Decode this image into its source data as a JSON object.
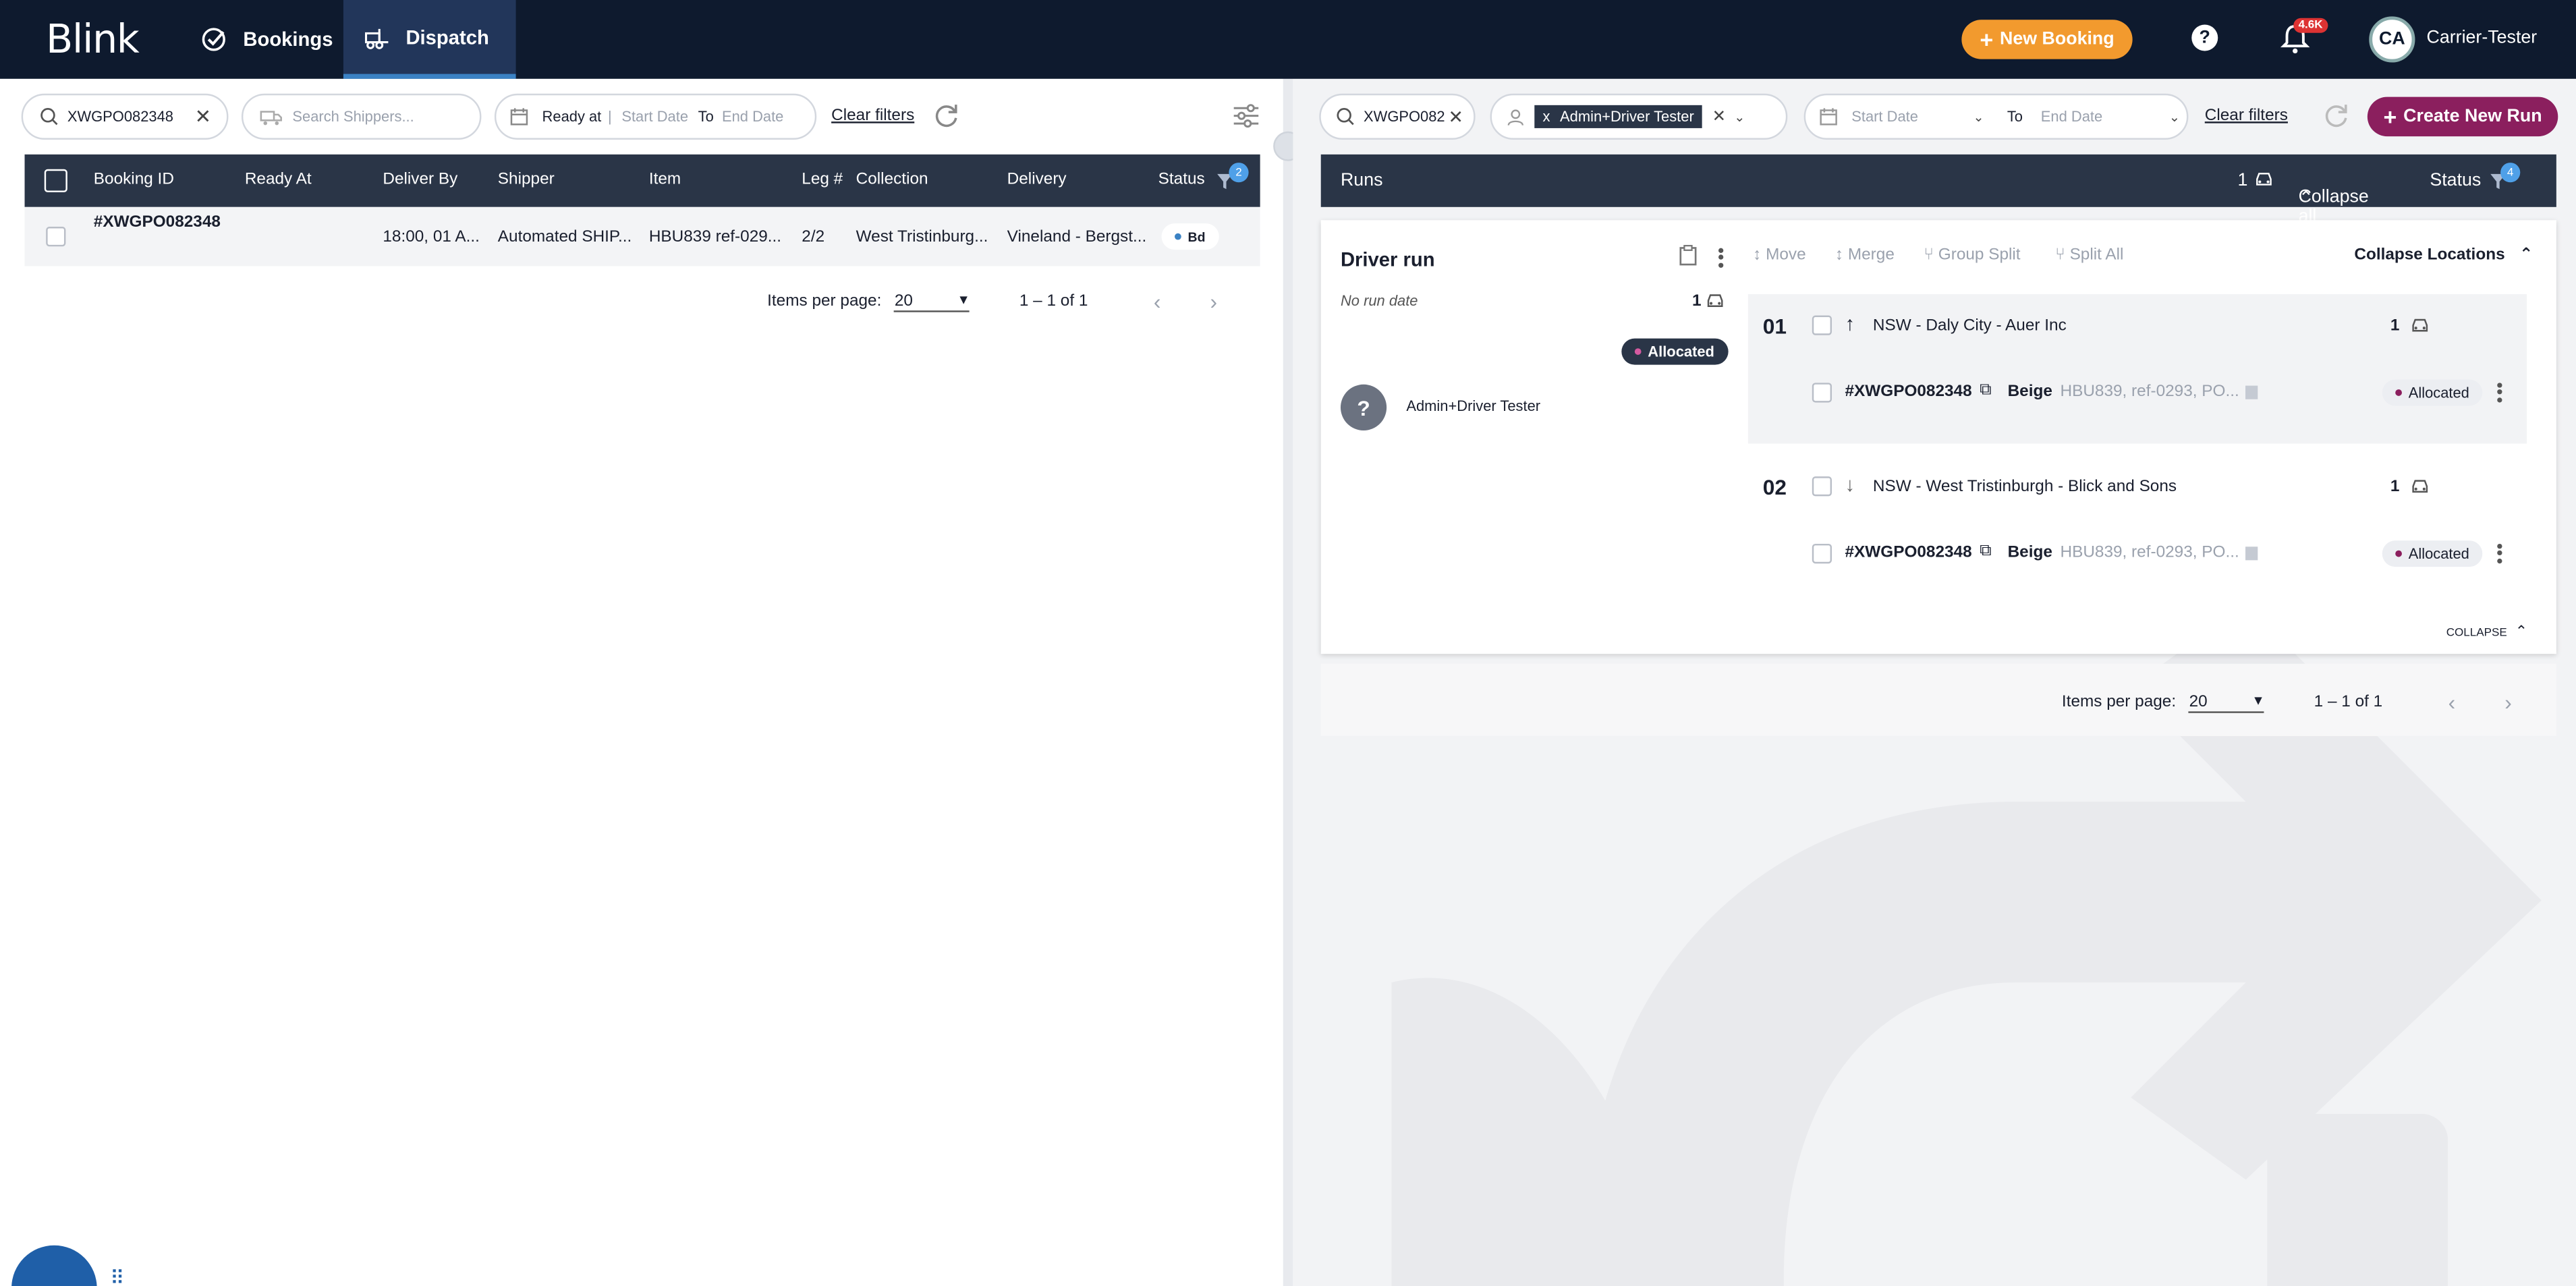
{
  "nav": {
    "logo": "Blink",
    "bookings": "Bookings",
    "dispatch": "Dispatch",
    "new_booking": "New Booking",
    "notif_count": "4.6K",
    "avatar": "CA",
    "user": "Carrier-Tester",
    "help": "?"
  },
  "left": {
    "search_value": "XWGPO082348",
    "shipper_placeholder": "Search Shippers...",
    "ready_at": "Ready at",
    "start_date": "Start Date",
    "to": "To",
    "end_date": "End Date",
    "clear_filters": "Clear filters",
    "columns": [
      "Booking ID",
      "Ready At",
      "Deliver By",
      "Shipper",
      "Item",
      "Leg #",
      "Collection",
      "Delivery",
      "Status"
    ],
    "status_filter_count": "2",
    "row": {
      "booking_id": "#XWGPO082348",
      "deliver_by": "18:00, 01 A...",
      "shipper": "Automated SHIP...",
      "item": "HBU839 ref-029...",
      "leg": "2/2",
      "collection": "West Tristinburg...",
      "delivery": "Vineland - Bergst...",
      "status": "Bd"
    },
    "pager": {
      "items_per_page": "Items per page:",
      "page_size": "20",
      "range": "1 – 1 of 1"
    }
  },
  "right": {
    "search_value": "XWGPO082",
    "driver_chip": "Admin+Driver Tester",
    "chip_x": "x",
    "start_date": "Start Date",
    "to": "To",
    "end_date": "End Date",
    "clear_filters": "Clear filters",
    "create_run": "Create New Run",
    "runs_header": {
      "title": "Runs",
      "count": "1",
      "collapse_all": "Collapse all",
      "status": "Status",
      "status_filter_count": "4"
    },
    "run": {
      "title": "Driver run",
      "no_run_date": "No run date",
      "vehicle_count": "1",
      "status": "Allocated",
      "driver_avatar": "?",
      "driver_name": "Admin+Driver Tester",
      "actions": [
        "Move",
        "Merge",
        "Group Split",
        "Split All"
      ],
      "collapse_locations": "Collapse Locations",
      "collapse": "COLLAPSE",
      "locations": [
        {
          "index": "01",
          "name": "NSW - Daly City - Auer Inc",
          "count": "1",
          "booking": "#XWGPO082348",
          "colour": "Beige",
          "detail": "HBU839, ref-0293, PO...",
          "status": "Allocated"
        },
        {
          "index": "02",
          "name": "NSW - West Tristinburgh - Blick and Sons",
          "count": "1",
          "booking": "#XWGPO082348",
          "colour": "Beige",
          "detail": "HBU839, ref-0293, PO...",
          "status": "Allocated"
        }
      ]
    },
    "pager": {
      "items_per_page": "Items per page:",
      "page_size": "20",
      "range": "1 – 1 of 1"
    }
  },
  "colors": {
    "nav_bg": "#0e1a2e",
    "accent_orange": "#f29a2e",
    "accent_plum": "#8b1f5e",
    "header_bg": "#2a3547"
  }
}
